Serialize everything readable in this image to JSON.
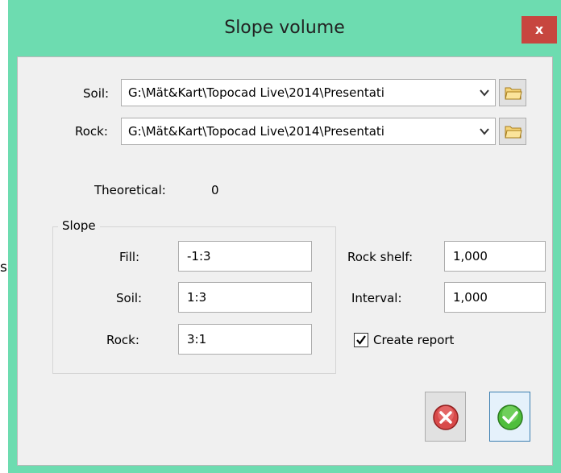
{
  "background": {
    "partial_text": "s"
  },
  "window": {
    "title": "Slope volume",
    "close_label": "x",
    "accent_color": "#6ddcb0"
  },
  "files": {
    "soil_label": "Soil:",
    "soil_value": "G:\\Mät&Kart\\Topocad Live\\2014\\Presentati",
    "rock_label": "Rock:",
    "rock_value": "G:\\Mät&Kart\\Topocad Live\\2014\\Presentati"
  },
  "theoretical": {
    "label": "Theoretical:",
    "value": "0"
  },
  "slope": {
    "group_title": "Slope",
    "fill_label": "Fill:",
    "fill_value": "-1:3",
    "soil_label": "Soil:",
    "soil_value": "1:3",
    "rock_label": "Rock:",
    "rock_value": "3:1"
  },
  "options": {
    "rock_shelf_label": "Rock shelf:",
    "rock_shelf_value": "1,000",
    "interval_label": "Interval:",
    "interval_value": "1,000",
    "create_report_label": "Create report",
    "create_report_checked": true
  },
  "icons": {
    "folder": "folder-icon",
    "cancel": "cancel-icon",
    "ok": "ok-icon",
    "dropdown": "chevron-down-icon"
  }
}
